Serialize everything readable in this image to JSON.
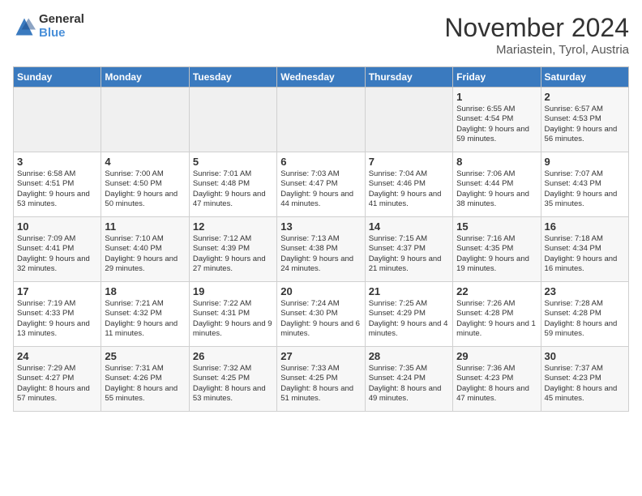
{
  "logo": {
    "general": "General",
    "blue": "Blue"
  },
  "title": "November 2024",
  "location": "Mariastein, Tyrol, Austria",
  "headers": [
    "Sunday",
    "Monday",
    "Tuesday",
    "Wednesday",
    "Thursday",
    "Friday",
    "Saturday"
  ],
  "weeks": [
    [
      {
        "day": "",
        "info": ""
      },
      {
        "day": "",
        "info": ""
      },
      {
        "day": "",
        "info": ""
      },
      {
        "day": "",
        "info": ""
      },
      {
        "day": "",
        "info": ""
      },
      {
        "day": "1",
        "info": "Sunrise: 6:55 AM\nSunset: 4:54 PM\nDaylight: 9 hours and 59 minutes."
      },
      {
        "day": "2",
        "info": "Sunrise: 6:57 AM\nSunset: 4:53 PM\nDaylight: 9 hours and 56 minutes."
      }
    ],
    [
      {
        "day": "3",
        "info": "Sunrise: 6:58 AM\nSunset: 4:51 PM\nDaylight: 9 hours and 53 minutes."
      },
      {
        "day": "4",
        "info": "Sunrise: 7:00 AM\nSunset: 4:50 PM\nDaylight: 9 hours and 50 minutes."
      },
      {
        "day": "5",
        "info": "Sunrise: 7:01 AM\nSunset: 4:48 PM\nDaylight: 9 hours and 47 minutes."
      },
      {
        "day": "6",
        "info": "Sunrise: 7:03 AM\nSunset: 4:47 PM\nDaylight: 9 hours and 44 minutes."
      },
      {
        "day": "7",
        "info": "Sunrise: 7:04 AM\nSunset: 4:46 PM\nDaylight: 9 hours and 41 minutes."
      },
      {
        "day": "8",
        "info": "Sunrise: 7:06 AM\nSunset: 4:44 PM\nDaylight: 9 hours and 38 minutes."
      },
      {
        "day": "9",
        "info": "Sunrise: 7:07 AM\nSunset: 4:43 PM\nDaylight: 9 hours and 35 minutes."
      }
    ],
    [
      {
        "day": "10",
        "info": "Sunrise: 7:09 AM\nSunset: 4:41 PM\nDaylight: 9 hours and 32 minutes."
      },
      {
        "day": "11",
        "info": "Sunrise: 7:10 AM\nSunset: 4:40 PM\nDaylight: 9 hours and 29 minutes."
      },
      {
        "day": "12",
        "info": "Sunrise: 7:12 AM\nSunset: 4:39 PM\nDaylight: 9 hours and 27 minutes."
      },
      {
        "day": "13",
        "info": "Sunrise: 7:13 AM\nSunset: 4:38 PM\nDaylight: 9 hours and 24 minutes."
      },
      {
        "day": "14",
        "info": "Sunrise: 7:15 AM\nSunset: 4:37 PM\nDaylight: 9 hours and 21 minutes."
      },
      {
        "day": "15",
        "info": "Sunrise: 7:16 AM\nSunset: 4:35 PM\nDaylight: 9 hours and 19 minutes."
      },
      {
        "day": "16",
        "info": "Sunrise: 7:18 AM\nSunset: 4:34 PM\nDaylight: 9 hours and 16 minutes."
      }
    ],
    [
      {
        "day": "17",
        "info": "Sunrise: 7:19 AM\nSunset: 4:33 PM\nDaylight: 9 hours and 13 minutes."
      },
      {
        "day": "18",
        "info": "Sunrise: 7:21 AM\nSunset: 4:32 PM\nDaylight: 9 hours and 11 minutes."
      },
      {
        "day": "19",
        "info": "Sunrise: 7:22 AM\nSunset: 4:31 PM\nDaylight: 9 hours and 9 minutes."
      },
      {
        "day": "20",
        "info": "Sunrise: 7:24 AM\nSunset: 4:30 PM\nDaylight: 9 hours and 6 minutes."
      },
      {
        "day": "21",
        "info": "Sunrise: 7:25 AM\nSunset: 4:29 PM\nDaylight: 9 hours and 4 minutes."
      },
      {
        "day": "22",
        "info": "Sunrise: 7:26 AM\nSunset: 4:28 PM\nDaylight: 9 hours and 1 minute."
      },
      {
        "day": "23",
        "info": "Sunrise: 7:28 AM\nSunset: 4:28 PM\nDaylight: 8 hours and 59 minutes."
      }
    ],
    [
      {
        "day": "24",
        "info": "Sunrise: 7:29 AM\nSunset: 4:27 PM\nDaylight: 8 hours and 57 minutes."
      },
      {
        "day": "25",
        "info": "Sunrise: 7:31 AM\nSunset: 4:26 PM\nDaylight: 8 hours and 55 minutes."
      },
      {
        "day": "26",
        "info": "Sunrise: 7:32 AM\nSunset: 4:25 PM\nDaylight: 8 hours and 53 minutes."
      },
      {
        "day": "27",
        "info": "Sunrise: 7:33 AM\nSunset: 4:25 PM\nDaylight: 8 hours and 51 minutes."
      },
      {
        "day": "28",
        "info": "Sunrise: 7:35 AM\nSunset: 4:24 PM\nDaylight: 8 hours and 49 minutes."
      },
      {
        "day": "29",
        "info": "Sunrise: 7:36 AM\nSunset: 4:23 PM\nDaylight: 8 hours and 47 minutes."
      },
      {
        "day": "30",
        "info": "Sunrise: 7:37 AM\nSunset: 4:23 PM\nDaylight: 8 hours and 45 minutes."
      }
    ]
  ]
}
